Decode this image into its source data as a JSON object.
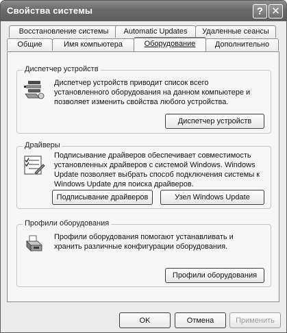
{
  "window": {
    "title": "Свойства системы"
  },
  "titlebar": {
    "help_glyph": "?",
    "close_glyph": "✕"
  },
  "tabs": {
    "row1": [
      {
        "label": "Восстановление системы"
      },
      {
        "label": "Automatic Updates"
      },
      {
        "label": "Удаленные сеансы"
      }
    ],
    "row2": [
      {
        "label": "Общие"
      },
      {
        "label": "Имя компьютера"
      },
      {
        "label": "Оборудование",
        "active": true
      },
      {
        "label": "Дополнительно"
      }
    ]
  },
  "groups": {
    "device_manager": {
      "title": "Диспетчер устройств",
      "description": "Диспетчер устройств приводит список всего установленного оборудования на данном компьютере и позволяет изменить свойства любого устройства.",
      "button": "Диспетчер устройств",
      "icon": "device-manager-icon"
    },
    "drivers": {
      "title": "Драйверы",
      "description": "Подписывание драйверов обеспечивает совместимость установленных драйверов с системой Windows.  Windows Update позволяет выбрать способ подключения системы к Windows Update для поиска драйверов.",
      "button_signing": "Подписывание драйверов",
      "button_update": "Узел Windows Update",
      "icon": "driver-checklist-icon"
    },
    "hardware_profiles": {
      "title": "Профили оборудования",
      "description": "Профили оборудования помогают устанавливать и хранить различные конфигурации оборудования.",
      "button": "Профили оборудования",
      "icon": "hardware-profiles-icon"
    }
  },
  "footer": {
    "ok": "OK",
    "cancel": "Отмена",
    "apply": "Применить"
  }
}
